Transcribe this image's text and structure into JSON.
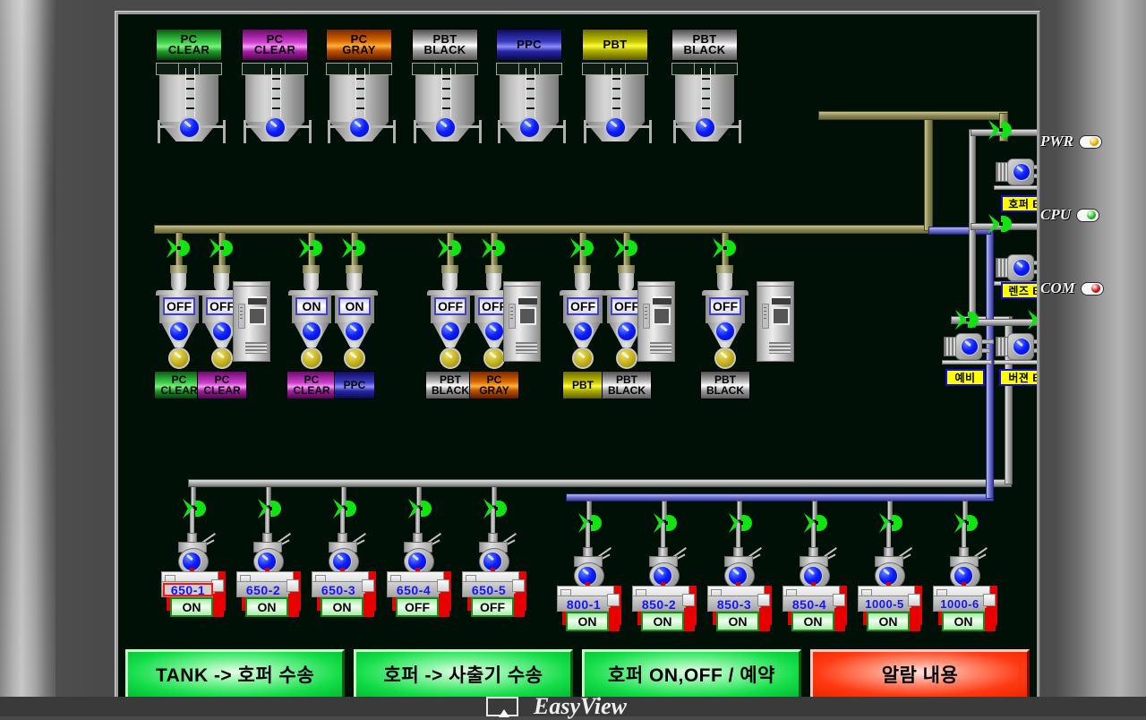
{
  "app": {
    "brand": "EasyView",
    "screen_bg": "#011006"
  },
  "indicators": [
    {
      "label": "PWR",
      "color": "#f0b400",
      "state": "on"
    },
    {
      "label": "CPU",
      "color": "#21c521",
      "state": "on"
    },
    {
      "label": "COM",
      "color": "#d41616",
      "state": "on"
    }
  ],
  "silos": [
    {
      "line1": "PC",
      "line2": "CLEAR",
      "color": "green",
      "grad": "linear-gradient(to bottom,#0a5c12,#3fd44b 42%,#7ff07f 56%,#1e9b28 72%,#063f0a)"
    },
    {
      "line1": "PC",
      "line2": "CLEAR",
      "color": "magenta",
      "grad": "linear-gradient(to bottom,#6d0a6d,#cf3ecf 42%,#f59cf5 56%,#a81ea8 72%,#4d064d)"
    },
    {
      "line1": "PC",
      "line2": "GRAY",
      "color": "orange",
      "grad": "linear-gradient(to bottom,#7a2600,#d96a00 38%,#ffb13c 54%,#c45400 70%,#5c1c00)"
    },
    {
      "line1": "PBT",
      "line2": "BLACK",
      "color": "silver",
      "grad": "linear-gradient(to bottom,#4d4d4d,#b9b9b9 36%,#ffffff 52%,#a0a0a0 70%,#585858)"
    },
    {
      "line1": "PPC",
      "line2": "",
      "color": "blue",
      "grad": "linear-gradient(to bottom,#0c0c5e,#3b3bc6 40%,#8f8ff5 56%,#2626a8 72%,#0a0a4c)"
    },
    {
      "line1": "PBT",
      "line2": "",
      "color": "yellow",
      "grad": "linear-gradient(to bottom,#6b6b00,#c9c900 40%,#fcfc3c 54%,#b3b300 70%,#5c5c00)"
    },
    {
      "line1": "PBT",
      "line2": "BLACK",
      "color": "silver",
      "grad": "linear-gradient(to bottom,#4d4d4d,#b9b9b9 36%,#ffffff 52%,#a0a0a0 70%,#585858)"
    }
  ],
  "hoppers": [
    {
      "state": "OFF",
      "line1": "PC",
      "line2": "CLEAR",
      "grad": "linear-gradient(to bottom,#0a5c12,#3fd44b 42%,#7ff07f 56%,#1e9b28 72%,#063f0a)"
    },
    {
      "state": "OFF",
      "line1": "PC",
      "line2": "CLEAR",
      "grad": "linear-gradient(to bottom,#6d0a6d,#cf3ecf 42%,#f59cf5 56%,#a81ea8 72%,#4d064d)"
    },
    {
      "state": "ON",
      "line1": "PC",
      "line2": "CLEAR",
      "grad": "linear-gradient(to bottom,#6d0a6d,#cf3ecf 42%,#f59cf5 56%,#a81ea8 72%,#4d064d)"
    },
    {
      "state": "ON",
      "line1": "PPC",
      "line2": "",
      "grad": "linear-gradient(to bottom,#0c0c5e,#3b3bc6 40%,#8f8ff5 56%,#2626a8 72%,#0a0a4c)"
    },
    {
      "state": "OFF",
      "line1": "PBT",
      "line2": "BLACK",
      "grad": "linear-gradient(to bottom,#4d4d4d,#b9b9b9 36%,#ffffff 52%,#a0a0a0 70%,#585858)"
    },
    {
      "state": "OFF",
      "line1": "PC",
      "line2": "GRAY",
      "grad": "linear-gradient(to bottom,#7a2600,#d96a00 38%,#ffb13c 54%,#c45400 70%,#5c1c00)"
    },
    {
      "state": "OFF",
      "line1": "PBT",
      "line2": "",
      "grad": "linear-gradient(to bottom,#6b6b00,#c9c900 40%,#fcfc3c 54%,#b3b300 70%,#5c5c00)"
    },
    {
      "state": "OFF",
      "line1": "PBT",
      "line2": "BLACK",
      "grad": "linear-gradient(to bottom,#4d4d4d,#b9b9b9 36%,#ffffff 52%,#a0a0a0 70%,#585858)"
    },
    {
      "state": "OFF",
      "line1": "PBT",
      "line2": "BLACK",
      "grad": "linear-gradient(to bottom,#4d4d4d,#b9b9b9 36%,#ffffff 52%,#a0a0a0 70%,#585858)"
    }
  ],
  "blowers": [
    {
      "label": "호퍼 BLOWER"
    },
    {
      "label": "렌즈 BLOWER"
    },
    {
      "label": "예비"
    },
    {
      "label": "버젼 BLOWER"
    }
  ],
  "machines": [
    {
      "tag": "650-1",
      "state": "ON",
      "alert": true
    },
    {
      "tag": "650-2",
      "state": "ON",
      "alert": false
    },
    {
      "tag": "650-3",
      "state": "ON",
      "alert": false
    },
    {
      "tag": "650-4",
      "state": "OFF",
      "alert": false
    },
    {
      "tag": "650-5",
      "state": "OFF",
      "alert": false
    },
    {
      "tag": "800-1",
      "state": "ON",
      "alert": false
    },
    {
      "tag": "850-2",
      "state": "ON",
      "alert": false
    },
    {
      "tag": "850-3",
      "state": "ON",
      "alert": false
    },
    {
      "tag": "850-4",
      "state": "ON",
      "alert": false
    },
    {
      "tag": "1000-5",
      "state": "ON",
      "alert": false
    },
    {
      "tag": "1000-6",
      "state": "ON",
      "alert": false
    }
  ],
  "buttons": [
    {
      "label": "TANK -> 호퍼 수송",
      "kind": "green"
    },
    {
      "label": "호퍼 -> 사출기 수송",
      "kind": "green"
    },
    {
      "label": "호퍼 ON,OFF / 예약",
      "kind": "green"
    },
    {
      "label": "알람 내용",
      "kind": "red"
    }
  ]
}
